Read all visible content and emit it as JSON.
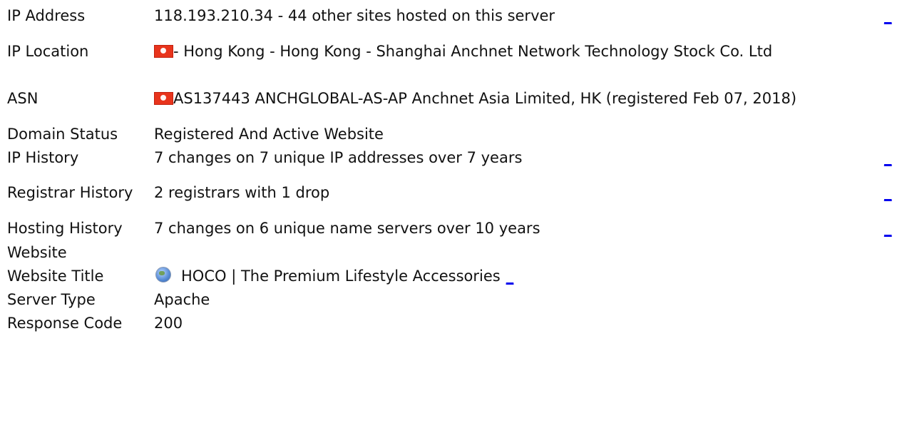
{
  "rows": {
    "ip_address": {
      "label": "IP Address",
      "value": "118.193.210.34 - 44 other sites hosted on this server"
    },
    "ip_location": {
      "label": "IP Location",
      "value": "- Hong Kong - Hong Kong - Shanghai Anchnet Network Technology Stock Co. Ltd",
      "flag_icon": "hong-kong-flag-icon"
    },
    "asn": {
      "label": "ASN",
      "value": "AS137443 ANCHGLOBAL-AS-AP Anchnet Asia Limited, HK (registered Feb 07, 2018)",
      "flag_icon": "hong-kong-flag-icon"
    },
    "domain_status": {
      "label": "Domain Status",
      "value": "Registered And Active Website"
    },
    "ip_history": {
      "label": "IP History",
      "value": "7 changes on 7 unique IP addresses over 7 years"
    },
    "registrar_history": {
      "label": "Registrar History",
      "value": "2 registrars with 1 drop"
    },
    "hosting_history": {
      "label": "Hosting History",
      "value": "7 changes on 6 unique name servers over 10 years"
    },
    "website_section": {
      "label": "Website"
    },
    "website_title": {
      "label": "Website Title",
      "value": "HOCO | The Premium Lifestyle Accessories",
      "icon": "globe-icon"
    },
    "server_type": {
      "label": "Server Type",
      "value": "Apache"
    },
    "response_code": {
      "label": "Response Code",
      "value": "200"
    }
  },
  "more_link_text": "_",
  "colors": {
    "link": "#0000ee",
    "text": "#111111",
    "flag_red": "#e8341c"
  }
}
